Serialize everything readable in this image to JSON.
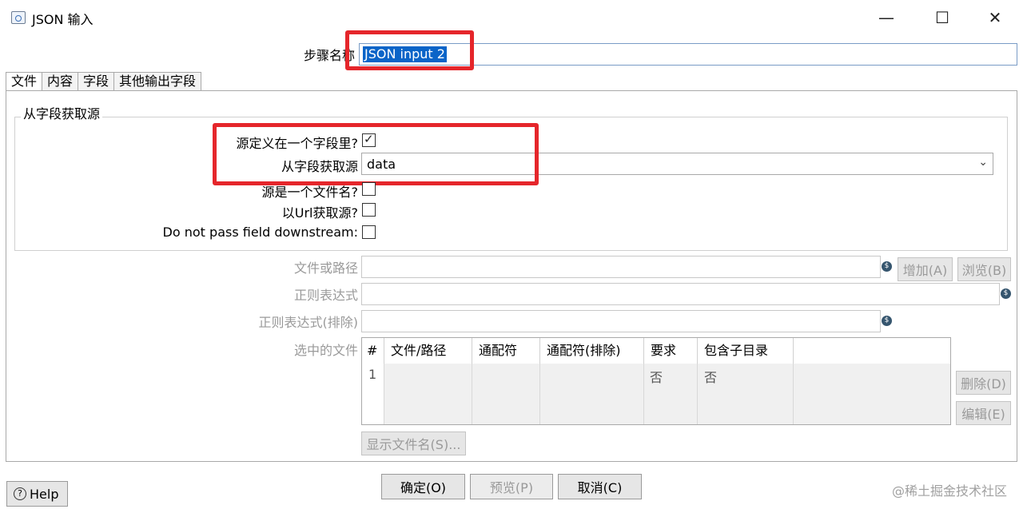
{
  "window": {
    "title": "JSON 输入",
    "minimize": "—",
    "maximize": "☐",
    "close": "✕"
  },
  "step": {
    "label": "步骤名称",
    "value": "JSON input 2"
  },
  "tabs": [
    {
      "label": "文件",
      "active": true
    },
    {
      "label": "内容",
      "active": false
    },
    {
      "label": "字段",
      "active": false
    },
    {
      "label": "其他输出字段",
      "active": false
    }
  ],
  "source_group": {
    "title": "从字段获取源",
    "source_in_field_label": "源定义在一个字段里?",
    "source_in_field_checked": true,
    "get_source_from_field_label": "从字段获取源",
    "get_source_from_field_value": "data",
    "source_is_filename_label": "源是一个文件名?",
    "source_is_filename_checked": false,
    "read_url_label": "以Url获取源?",
    "read_url_checked": false,
    "do_not_pass_label": "Do not pass field downstream:",
    "do_not_pass_checked": false
  },
  "file": {
    "path_label": "文件或路径",
    "regex_label": "正则表达式",
    "regex_exclude_label": "正则表达式(排除)",
    "selected_files_label": "选中的文件",
    "add_button": "增加(A)",
    "browse_button": "浏览(B)",
    "delete_button": "删除(D)",
    "edit_button": "编辑(E)",
    "show_filenames_button": "显示文件名(S)...",
    "var_icon": "$"
  },
  "table": {
    "headers": [
      "#",
      "文件/路径",
      "通配符",
      "通配符(排除)",
      "要求",
      "包含子目录"
    ],
    "rows": [
      {
        "num": "1",
        "path": "",
        "wildcard": "",
        "wildcard_exclude": "",
        "required": "否",
        "subdirs": "否"
      }
    ]
  },
  "buttons": {
    "ok": "确定(O)",
    "preview": "预览(P)",
    "cancel": "取消(C)",
    "help": "Help",
    "help_icon": "?"
  },
  "watermark": "@稀土掘金技术社区",
  "colors": {
    "highlight": "#e5262b",
    "selection": "#0a64c8"
  }
}
